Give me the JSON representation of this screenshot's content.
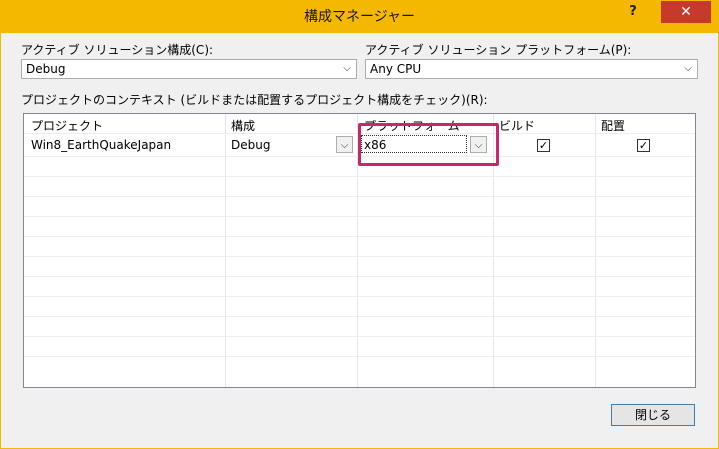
{
  "window": {
    "title": "構成マネージャー",
    "help_label": "?",
    "close_label": "✕"
  },
  "active_solution": {
    "label": "アクティブ ソリューション構成(C):",
    "value": "Debug"
  },
  "active_platform": {
    "label": "アクティブ ソリューション プラットフォーム(P):",
    "value": "Any CPU"
  },
  "contexts_label": "プロジェクトのコンテキスト (ビルドまたは配置するプロジェクト構成をチェック)(R):",
  "grid": {
    "headers": {
      "project": "プロジェクト",
      "config": "構成",
      "platform": "プラットフォーム",
      "build": "ビルド",
      "deploy": "配置"
    },
    "rows": [
      {
        "project": "Win8_EarthQuakeJapan",
        "config": "Debug",
        "platform": "x86",
        "build": true,
        "deploy": true
      }
    ]
  },
  "close_button": "閉じる",
  "icons": {
    "dropdown": "chevron-down-icon",
    "check": "checkmark-icon"
  },
  "colors": {
    "titlebar": "#f5b800",
    "close": "#c7392b",
    "highlight": "#c8286a"
  }
}
